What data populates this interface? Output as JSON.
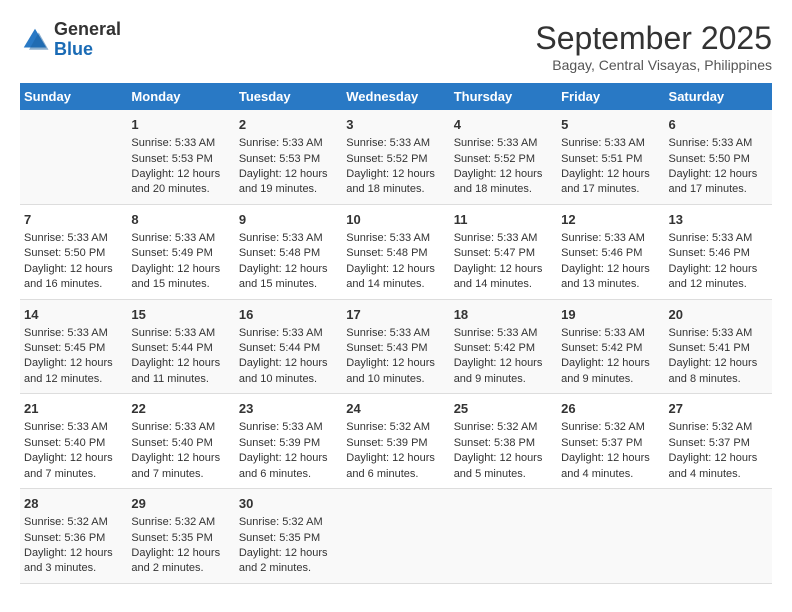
{
  "header": {
    "logo": {
      "line1": "General",
      "line2": "Blue"
    },
    "title": "September 2025",
    "subtitle": "Bagay, Central Visayas, Philippines"
  },
  "days_of_week": [
    "Sunday",
    "Monday",
    "Tuesday",
    "Wednesday",
    "Thursday",
    "Friday",
    "Saturday"
  ],
  "weeks": [
    [
      {
        "day": "",
        "content": ""
      },
      {
        "day": "1",
        "content": "Sunrise: 5:33 AM\nSunset: 5:53 PM\nDaylight: 12 hours\nand 20 minutes."
      },
      {
        "day": "2",
        "content": "Sunrise: 5:33 AM\nSunset: 5:53 PM\nDaylight: 12 hours\nand 19 minutes."
      },
      {
        "day": "3",
        "content": "Sunrise: 5:33 AM\nSunset: 5:52 PM\nDaylight: 12 hours\nand 18 minutes."
      },
      {
        "day": "4",
        "content": "Sunrise: 5:33 AM\nSunset: 5:52 PM\nDaylight: 12 hours\nand 18 minutes."
      },
      {
        "day": "5",
        "content": "Sunrise: 5:33 AM\nSunset: 5:51 PM\nDaylight: 12 hours\nand 17 minutes."
      },
      {
        "day": "6",
        "content": "Sunrise: 5:33 AM\nSunset: 5:50 PM\nDaylight: 12 hours\nand 17 minutes."
      }
    ],
    [
      {
        "day": "7",
        "content": "Sunrise: 5:33 AM\nSunset: 5:50 PM\nDaylight: 12 hours\nand 16 minutes."
      },
      {
        "day": "8",
        "content": "Sunrise: 5:33 AM\nSunset: 5:49 PM\nDaylight: 12 hours\nand 15 minutes."
      },
      {
        "day": "9",
        "content": "Sunrise: 5:33 AM\nSunset: 5:48 PM\nDaylight: 12 hours\nand 15 minutes."
      },
      {
        "day": "10",
        "content": "Sunrise: 5:33 AM\nSunset: 5:48 PM\nDaylight: 12 hours\nand 14 minutes."
      },
      {
        "day": "11",
        "content": "Sunrise: 5:33 AM\nSunset: 5:47 PM\nDaylight: 12 hours\nand 14 minutes."
      },
      {
        "day": "12",
        "content": "Sunrise: 5:33 AM\nSunset: 5:46 PM\nDaylight: 12 hours\nand 13 minutes."
      },
      {
        "day": "13",
        "content": "Sunrise: 5:33 AM\nSunset: 5:46 PM\nDaylight: 12 hours\nand 12 minutes."
      }
    ],
    [
      {
        "day": "14",
        "content": "Sunrise: 5:33 AM\nSunset: 5:45 PM\nDaylight: 12 hours\nand 12 minutes."
      },
      {
        "day": "15",
        "content": "Sunrise: 5:33 AM\nSunset: 5:44 PM\nDaylight: 12 hours\nand 11 minutes."
      },
      {
        "day": "16",
        "content": "Sunrise: 5:33 AM\nSunset: 5:44 PM\nDaylight: 12 hours\nand 10 minutes."
      },
      {
        "day": "17",
        "content": "Sunrise: 5:33 AM\nSunset: 5:43 PM\nDaylight: 12 hours\nand 10 minutes."
      },
      {
        "day": "18",
        "content": "Sunrise: 5:33 AM\nSunset: 5:42 PM\nDaylight: 12 hours\nand 9 minutes."
      },
      {
        "day": "19",
        "content": "Sunrise: 5:33 AM\nSunset: 5:42 PM\nDaylight: 12 hours\nand 9 minutes."
      },
      {
        "day": "20",
        "content": "Sunrise: 5:33 AM\nSunset: 5:41 PM\nDaylight: 12 hours\nand 8 minutes."
      }
    ],
    [
      {
        "day": "21",
        "content": "Sunrise: 5:33 AM\nSunset: 5:40 PM\nDaylight: 12 hours\nand 7 minutes."
      },
      {
        "day": "22",
        "content": "Sunrise: 5:33 AM\nSunset: 5:40 PM\nDaylight: 12 hours\nand 7 minutes."
      },
      {
        "day": "23",
        "content": "Sunrise: 5:33 AM\nSunset: 5:39 PM\nDaylight: 12 hours\nand 6 minutes."
      },
      {
        "day": "24",
        "content": "Sunrise: 5:32 AM\nSunset: 5:39 PM\nDaylight: 12 hours\nand 6 minutes."
      },
      {
        "day": "25",
        "content": "Sunrise: 5:32 AM\nSunset: 5:38 PM\nDaylight: 12 hours\nand 5 minutes."
      },
      {
        "day": "26",
        "content": "Sunrise: 5:32 AM\nSunset: 5:37 PM\nDaylight: 12 hours\nand 4 minutes."
      },
      {
        "day": "27",
        "content": "Sunrise: 5:32 AM\nSunset: 5:37 PM\nDaylight: 12 hours\nand 4 minutes."
      }
    ],
    [
      {
        "day": "28",
        "content": "Sunrise: 5:32 AM\nSunset: 5:36 PM\nDaylight: 12 hours\nand 3 minutes."
      },
      {
        "day": "29",
        "content": "Sunrise: 5:32 AM\nSunset: 5:35 PM\nDaylight: 12 hours\nand 2 minutes."
      },
      {
        "day": "30",
        "content": "Sunrise: 5:32 AM\nSunset: 5:35 PM\nDaylight: 12 hours\nand 2 minutes."
      },
      {
        "day": "",
        "content": ""
      },
      {
        "day": "",
        "content": ""
      },
      {
        "day": "",
        "content": ""
      },
      {
        "day": "",
        "content": ""
      }
    ]
  ]
}
